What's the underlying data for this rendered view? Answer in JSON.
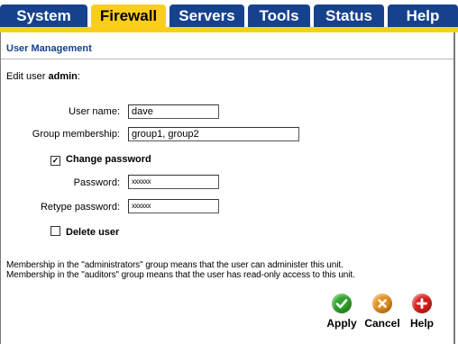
{
  "nav": {
    "tabs": [
      "System",
      "Firewall",
      "Servers",
      "Tools",
      "Status",
      "Help"
    ],
    "active": "Firewall"
  },
  "page": {
    "heading": "User Management",
    "edit_prefix": "Edit user",
    "edit_user": "admin",
    "edit_suffix": ":"
  },
  "form": {
    "username_label": "User name:",
    "username_value": "dave",
    "group_label": "Group membership:",
    "group_value": "group1, group2",
    "change_password_label": "Change password",
    "change_password_checked": true,
    "password_label": "Password:",
    "password_value": "xxxxxx",
    "retype_label": "Retype password:",
    "retype_value": "xxxxxx",
    "delete_user_label": "Delete user",
    "delete_user_checked": false
  },
  "notes": [
    "Membership in the \"administrators\" group means that the user can administer this unit.",
    "Membership in the \"auditors\" group means that the user has read-only access to this unit."
  ],
  "actions": {
    "apply": "Apply",
    "cancel": "Cancel",
    "help": "Help"
  },
  "colors": {
    "nav_blue": "#16418d",
    "nav_active": "#fcce1c",
    "apply_green": "#2fa52a",
    "cancel_orange": "#e8901a",
    "help_red": "#d8201c"
  }
}
